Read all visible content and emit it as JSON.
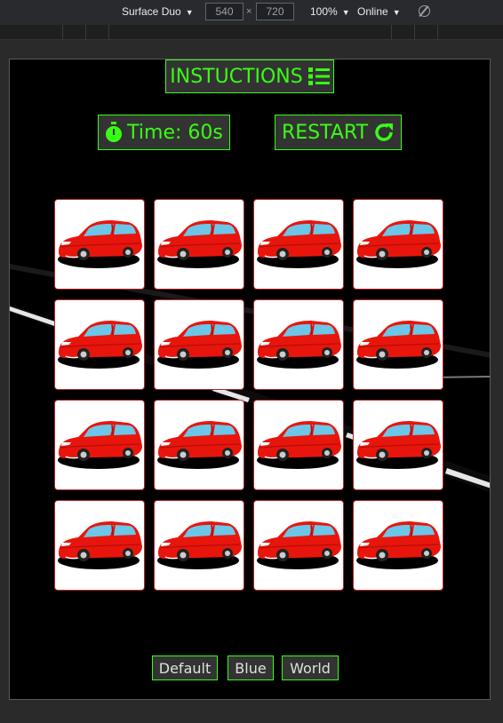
{
  "devtools": {
    "device": "Surface Duo",
    "width": "540",
    "height": "720",
    "zoom": "100%",
    "network": "Online"
  },
  "game": {
    "instructions_label": "INSTUCTIONS",
    "timer_label": "Time: 60s",
    "restart_label": "RESTART",
    "card_face": "red-car",
    "card_count": 16,
    "themes": [
      "Default",
      "Blue",
      "World"
    ],
    "colors": {
      "accent": "#39ff14",
      "button_bg": "#333333",
      "card_border": "#b3262b",
      "background": "#000000"
    }
  }
}
